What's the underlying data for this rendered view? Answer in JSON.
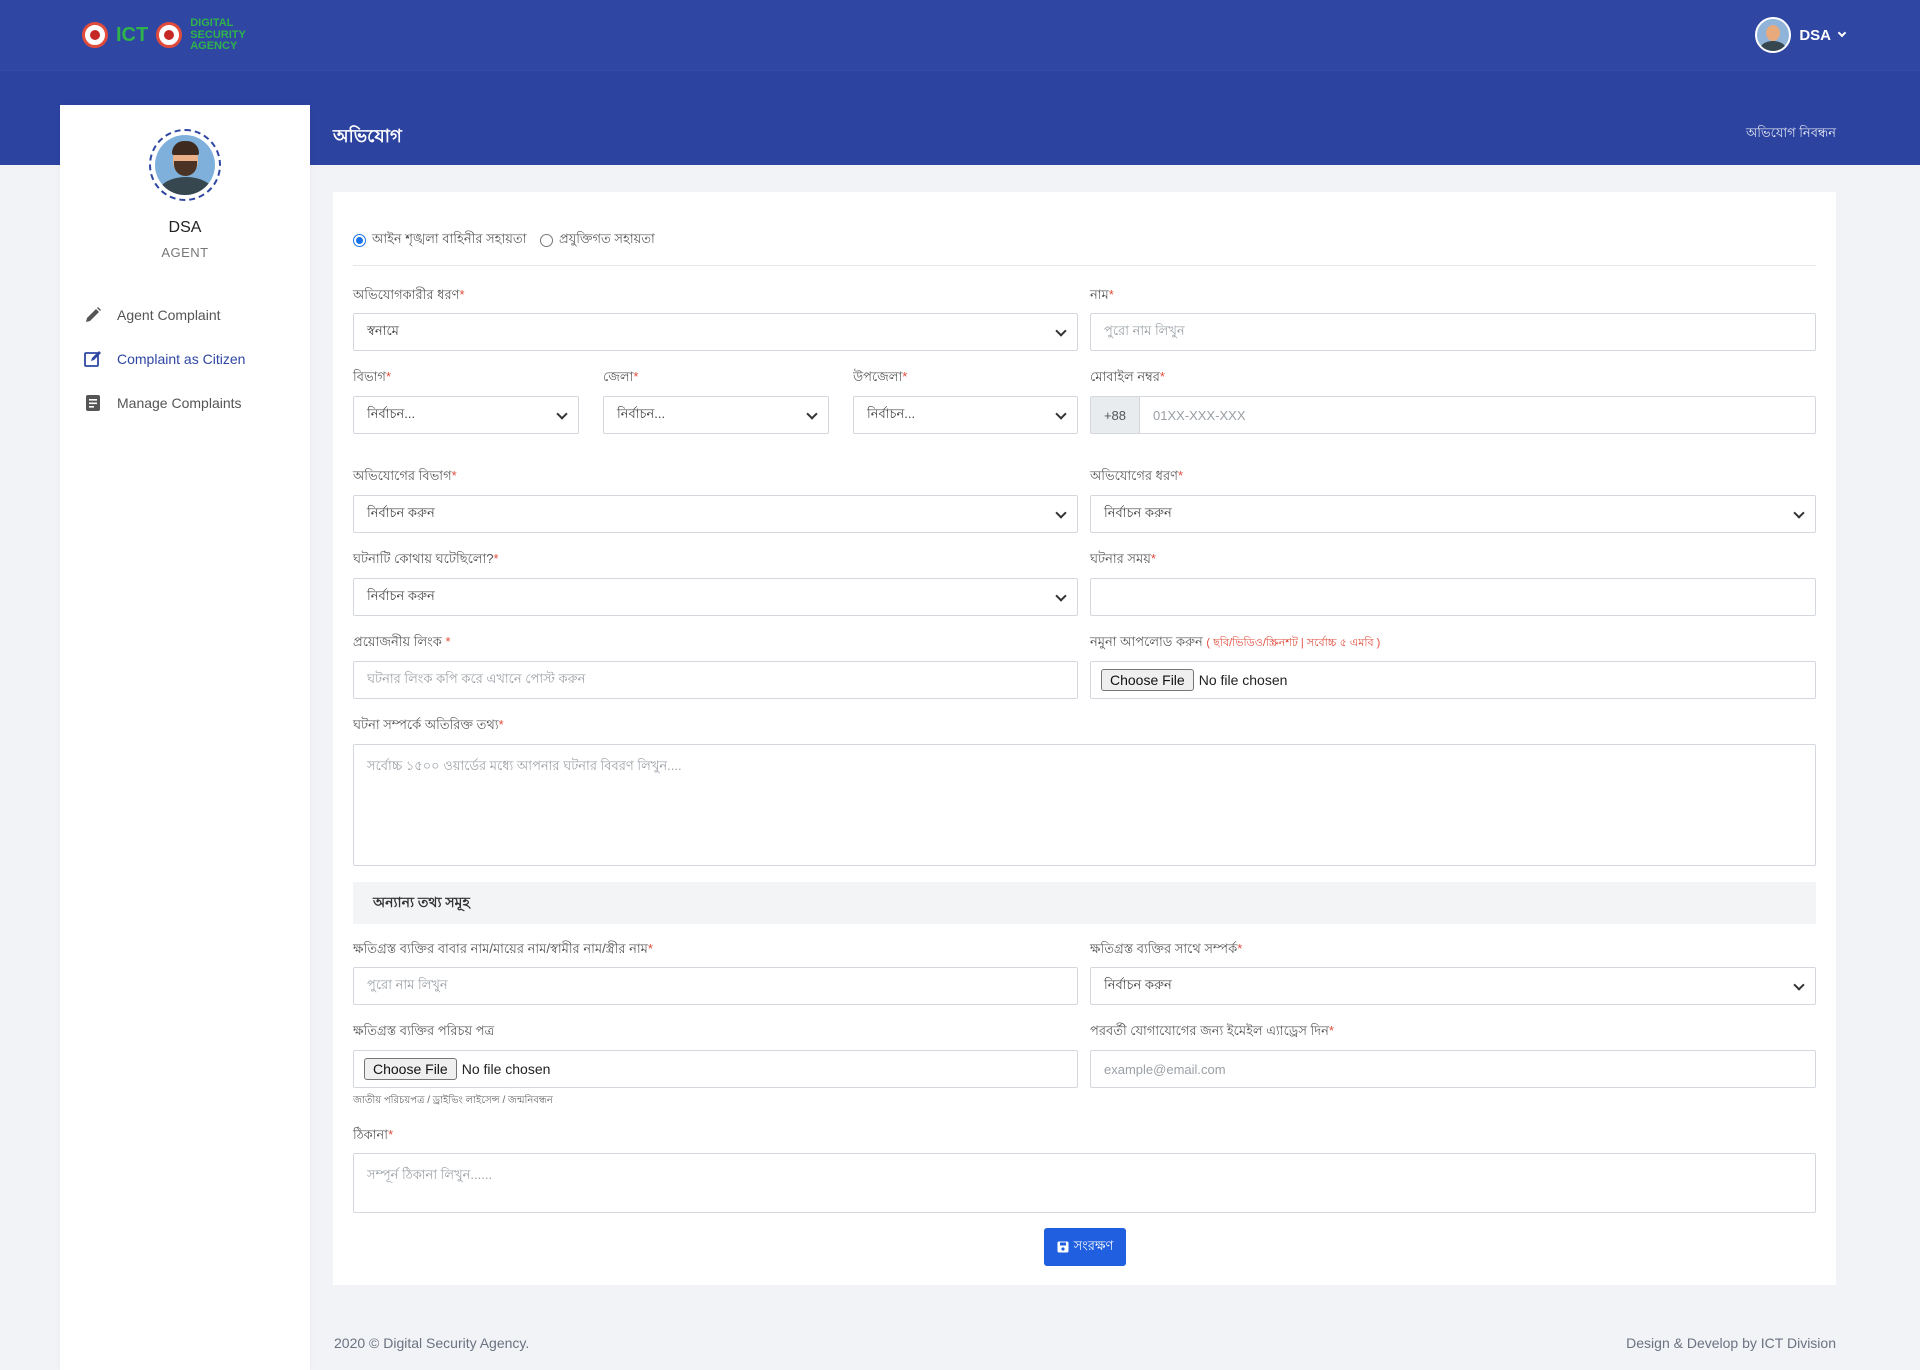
{
  "header": {
    "logo_icon": "ict-division-logo",
    "logo_text_1": "ICT",
    "logo_text_2": "DIGITAL SECURITY AGENCY",
    "user_label": "DSA",
    "page_title": "অভিযোগ",
    "page_link": "অভিযোগ নিবন্ধন"
  },
  "sidebar": {
    "name": "DSA",
    "role": "AGENT",
    "items": [
      {
        "label": "Agent Complaint",
        "icon": "pencil-icon"
      },
      {
        "label": "Complaint as Citizen",
        "icon": "edit-square-icon",
        "active": true
      },
      {
        "label": "Manage Complaints",
        "icon": "list-doc-icon"
      }
    ]
  },
  "form": {
    "radio_1": "আইন শৃঙ্খলা বাহিনীর সহায়তা",
    "radio_2": "প্রযুক্তিগত সহায়তা",
    "complainant_type_label": "অভিযোগকারীর ধরণ",
    "complainant_type_value": "স্বনামে",
    "name_label": "নাম",
    "name_placeholder": "পুরো নাম লিখুন",
    "division_label": "বিভাগ",
    "division_value": "নির্বাচন...",
    "district_label": "জেলা",
    "district_value": "নির্বাচন...",
    "upazila_label": "উপজেলা",
    "upazila_value": "নির্বাচন...",
    "mobile_label": "মোবাইল নম্বর",
    "mobile_prefix": "+88",
    "mobile_placeholder": "01XX-XXX-XXX",
    "complaint_division_label": "অভিযোগের বিভাগ",
    "complaint_division_value": "নির্বাচন করুন",
    "complaint_type_label": "অভিযোগের ধরণ",
    "complaint_type_value": "নির্বাচন করুন",
    "where_label": "ঘটনাটি কোথায় ঘটেছিলো?",
    "where_value": "নির্বাচন করুন",
    "time_label": "ঘটনার সময়",
    "link_label": "প্রয়োজনীয় লিংক",
    "link_placeholder": "ঘটনার লিংক কপি করে এখানে পোস্ট করুন",
    "upload_label": "নমুনা আপলোড করুন",
    "upload_note": "( ছবি/ভিডিও/স্ক্রিনশট | সর্বোচ্চ ৫ এমবি )",
    "file_button": "Choose File",
    "file_text": "No file chosen",
    "details_label": "ঘটনা সম্পর্কে অতিরিক্ত তথ্য",
    "details_placeholder": "সর্বোচ্চ ১৫০০ ওয়ার্ডের মধ্যে আপনার ঘটনার বিবরণ লিখুন....",
    "section_title": "অন্যান্য তথ্য সমূহ",
    "parent_label": "ক্ষতিগ্রস্ত ব্যক্তির বাবার নাম/মায়ের নাম/স্বামীর নাম/স্ত্রীর নাম",
    "parent_placeholder": "পুরো নাম লিখুন",
    "relation_label": "ক্ষতিগ্রস্ত ব্যক্তির সাথে সম্পর্ক",
    "relation_value": "নির্বাচন করুন",
    "id_label": "ক্ষতিগ্রস্ত ব্যক্তির পরিচয় পত্র",
    "id_hint": "জাতীয় পরিচয়পত্র / ড্রাইভিং লাইসেন্স / জন্মনিবন্ধন",
    "email_label": "পরবর্তী যোগাযোগের জন্য ইমেইল এ্যাড্রেস দিন",
    "email_placeholder": "example@email.com",
    "address_label": "ঠিকানা",
    "address_placeholder": "সম্পূর্ন ঠিকানা লিখুন......",
    "save_label": "সংরক্ষণ",
    "required_mark": "*"
  },
  "footer": {
    "left": "2020 © Digital Security Agency.",
    "right": "Design & Develop by ICT Division"
  },
  "colors": {
    "primary": "#2f47a3",
    "button": "#1f5fe0",
    "required": "#e14b3b"
  }
}
